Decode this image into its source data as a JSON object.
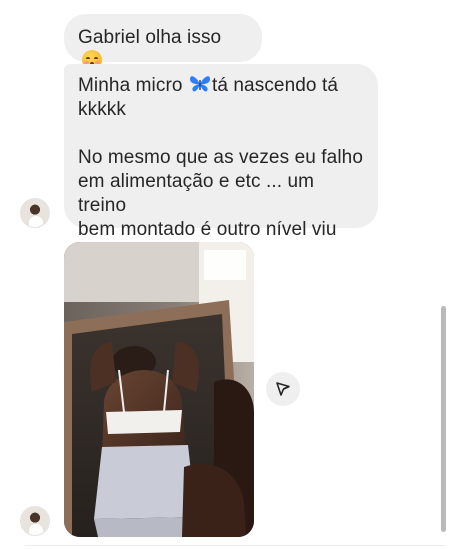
{
  "messages": [
    {
      "type": "text",
      "text": "Gabriel olha isso",
      "emoji": "blush-icon"
    },
    {
      "type": "text",
      "line1_before": "Minha micro",
      "emoji": "butterfly-icon",
      "line1_after": "tá nascendo tá",
      "line2": "kkkkk",
      "line3": "No mesmo que as vezes eu falho",
      "line4": "em alimentação e etc ... um treino",
      "line5": "bem montado é outro nível viu"
    },
    {
      "type": "media",
      "icon": "photo-icon"
    }
  ],
  "colors": {
    "bubble": "#efefef",
    "text": "#262626",
    "butterfly": "#2f7cff",
    "share_button": "#efefef"
  },
  "icons": {
    "share": "send-arrow-icon"
  }
}
